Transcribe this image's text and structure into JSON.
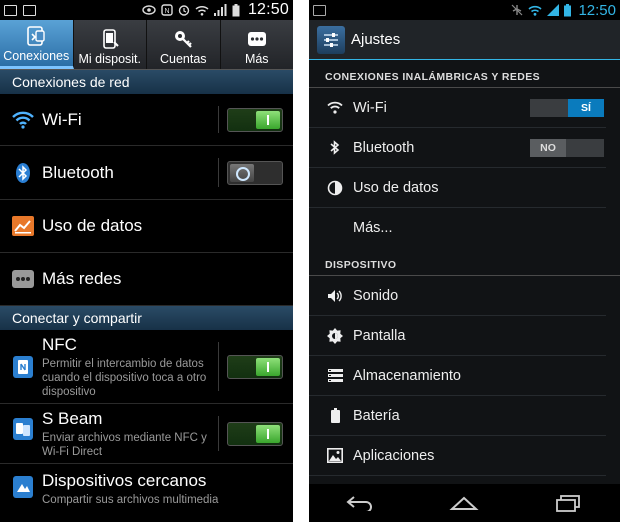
{
  "left": {
    "status": {
      "time": "12:50"
    },
    "tabs": [
      {
        "label": "Conexiones",
        "icon": "connections-icon",
        "active": true
      },
      {
        "label": "Mi disposit.",
        "icon": "device-icon",
        "active": false
      },
      {
        "label": "Cuentas",
        "icon": "key-icon",
        "active": false
      },
      {
        "label": "Más",
        "icon": "more-dots-icon",
        "active": false
      }
    ],
    "sections": [
      {
        "title": "Conexiones de red",
        "items": [
          {
            "label": "Wi-Fi",
            "icon": "wifi-icon",
            "toggle": "on"
          },
          {
            "label": "Bluetooth",
            "icon": "bluetooth-icon",
            "toggle": "off"
          },
          {
            "label": "Uso de datos",
            "icon": "data-usage-icon"
          },
          {
            "label": "Más redes",
            "icon": "more-networks-icon"
          }
        ]
      },
      {
        "title": "Conectar y compartir",
        "items": [
          {
            "label": "NFC",
            "sub": "Permitir el intercambio de datos cuando el dispositivo toca a otro dispositivo",
            "icon": "nfc-icon",
            "toggle": "on"
          },
          {
            "label": "S Beam",
            "sub": "Enviar archivos mediante NFC y Wi-Fi Direct",
            "icon": "s-beam-icon",
            "toggle": "on"
          },
          {
            "label": "Dispositivos cercanos",
            "sub": "Compartir sus archivos multimedia",
            "icon": "nearby-devices-icon"
          }
        ]
      }
    ]
  },
  "right": {
    "status": {
      "time": "12:50"
    },
    "title": "Ajustes",
    "sections": [
      {
        "title": "CONEXIONES INALÁMBRICAS Y REDES",
        "items": [
          {
            "label": "Wi-Fi",
            "icon": "wifi-icon",
            "switch": "SÍ"
          },
          {
            "label": "Bluetooth",
            "icon": "bluetooth-icon",
            "switch": "NO"
          },
          {
            "label": "Uso de datos",
            "icon": "data-usage-icon"
          },
          {
            "label": "Más...",
            "icon": ""
          }
        ]
      },
      {
        "title": "DISPOSITIVO",
        "items": [
          {
            "label": "Sonido",
            "icon": "volume-icon"
          },
          {
            "label": "Pantalla",
            "icon": "brightness-icon"
          },
          {
            "label": "Almacenamiento",
            "icon": "storage-icon"
          },
          {
            "label": "Batería",
            "icon": "battery-icon"
          },
          {
            "label": "Aplicaciones",
            "icon": "apps-icon"
          }
        ]
      }
    ],
    "navbar": [
      "back-icon",
      "home-icon",
      "recents-icon"
    ]
  }
}
